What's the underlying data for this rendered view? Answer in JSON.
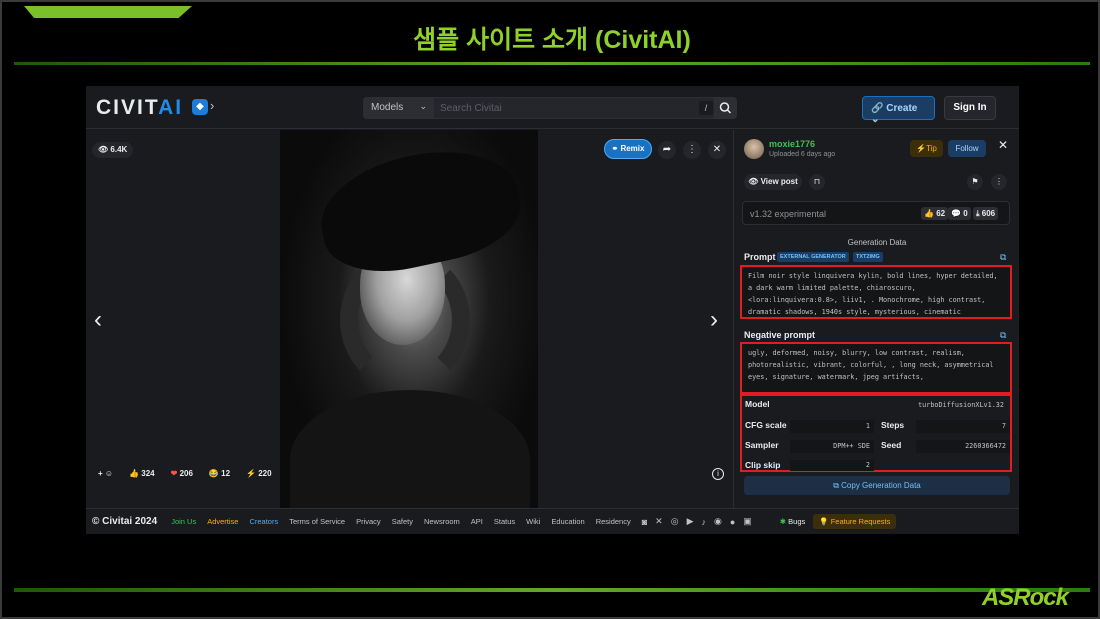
{
  "slide": {
    "title": "샘플 사이트 소개 (CivitAI)",
    "brand": "ASRock"
  },
  "header": {
    "logo_text_civit": "CIVIT",
    "logo_text_ai": "AI",
    "badge_icon": "cube-icon",
    "models_label": "Models",
    "search_placeholder": "Search Civitai",
    "slash_hint": "/",
    "create_label": "Create",
    "signin_label": "Sign In"
  },
  "viewer": {
    "views": "6.4K",
    "remix_label": "Remix",
    "reactions": [
      {
        "icon": "👍",
        "count": "324"
      },
      {
        "icon": "❤",
        "count": "206"
      },
      {
        "icon": "😂",
        "count": "12"
      },
      {
        "icon": "⚡",
        "count": "220"
      }
    ]
  },
  "sidebar": {
    "username": "moxie1776",
    "uploaded": "Uploaded 6 days ago",
    "tip_label": "Tip",
    "follow_label": "Follow",
    "view_post_label": "View post",
    "version": "v1.32 experimental",
    "stats": {
      "likes": "62",
      "comments": "0",
      "downloads": "606"
    },
    "generation_data_title": "Generation Data",
    "prompt_label": "Prompt",
    "tags": [
      "EXTERNAL GENERATOR",
      "TXT2IMG"
    ],
    "prompt_text": "Film noir style linquivera kylin, bold lines, hyper detailed, a dark warm limited palette, chiaroscuro, <lora:linquivera:0.8>, liiv1, . Monochrome, high contrast, dramatic shadows, 1940s style, mysterious, cinematic",
    "negative_label": "Negative prompt",
    "negative_text": "ugly, deformed, noisy, blurry, low contrast, realism, photorealistic, vibrant, colorful, , long neck, asymmetrical eyes, signature, watermark, jpeg artifacts,",
    "params": {
      "model_label": "Model",
      "model_value": "turboDiffusionXLv1.32",
      "cfg_label": "CFG scale",
      "cfg_value": "1",
      "steps_label": "Steps",
      "steps_value": "7",
      "sampler_label": "Sampler",
      "sampler_value": "DPM++ SDE",
      "seed_label": "Seed",
      "seed_value": "2260366472",
      "clip_label": "Clip skip",
      "clip_value": "2"
    },
    "copy_gen_label": "Copy Generation Data"
  },
  "footer": {
    "copyright": "© Civitai 2024",
    "links": [
      "Join Us",
      "Advertise",
      "Creators",
      "Terms of Service",
      "Privacy",
      "Safety",
      "Newsroom",
      "API",
      "Status",
      "Wiki",
      "Education",
      "Residency"
    ],
    "bugs_label": "Bugs",
    "feature_label": "Feature Requests"
  },
  "colors": {
    "accent_green": "#8fd12a",
    "civitai_blue": "#228be6",
    "highlight_red": "#e31b23"
  }
}
